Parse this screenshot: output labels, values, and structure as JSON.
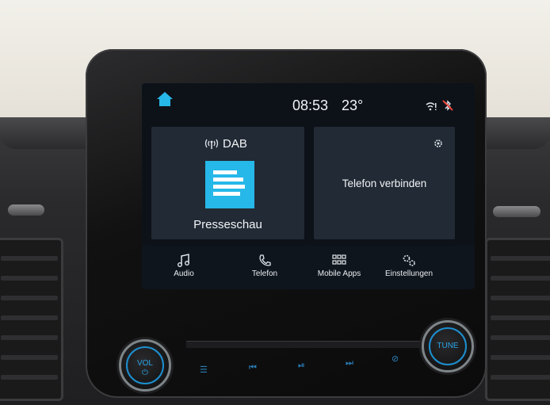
{
  "status_bar": {
    "time": "08:53",
    "temperature": "23°"
  },
  "media_tile": {
    "source": "DAB",
    "station": "Presseschau",
    "logo_color": "#26b8e8"
  },
  "phone_tile": {
    "label": "Telefon verbinden"
  },
  "nav": [
    {
      "label": "Audio",
      "icon": "music-note-icon"
    },
    {
      "label": "Telefon",
      "icon": "phone-icon"
    },
    {
      "label": "Mobile Apps",
      "icon": "apps-grid-icon"
    },
    {
      "label": "Einstellungen",
      "icon": "gears-icon"
    }
  ],
  "hardware": {
    "vol_label": "VOL",
    "tune_label": "TUNE"
  },
  "colors": {
    "accent": "#26b8e8",
    "tile_bg": "#222a35",
    "screen_bg": "#0d1219"
  }
}
